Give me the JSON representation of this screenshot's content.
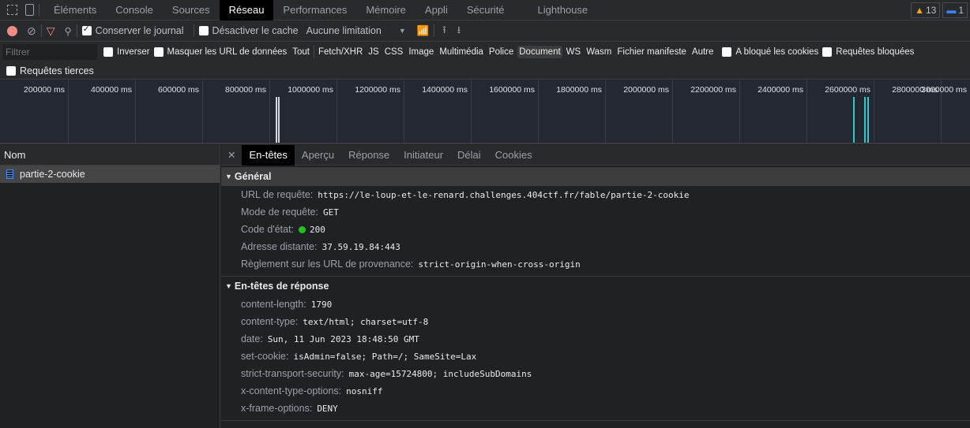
{
  "tabs": [
    "Éléments",
    "Console",
    "Sources",
    "Réseau",
    "Performances",
    "Mémoire",
    "Appli",
    "Sécurité",
    "Lighthouse"
  ],
  "active_tab": "Réseau",
  "badges": {
    "warnings": "13",
    "messages": "1"
  },
  "toolbar": {
    "preserve_log": "Conserver le journal",
    "disable_cache": "Désactiver le cache",
    "throttling": "Aucune limitation"
  },
  "filter": {
    "placeholder": "Filtrer",
    "invert": "Inverser",
    "hide_data_urls": "Masquer les URL de données",
    "types": [
      "Tout",
      "Fetch/XHR",
      "JS",
      "CSS",
      "Image",
      "Multimédia",
      "Police",
      "Document",
      "WS",
      "Wasm",
      "Fichier manifeste",
      "Autre"
    ],
    "selected_type": "Document",
    "blocked_cookies": "A bloqué les cookies",
    "blocked_requests": "Requêtes bloquées",
    "third_party": "Requêtes tierces"
  },
  "overview": {
    "ticks": [
      "200000 ms",
      "400000 ms",
      "600000 ms",
      "800000 ms",
      "1000000 ms",
      "1200000 ms",
      "1400000 ms",
      "1600000 ms",
      "1800000 ms",
      "2000000 ms",
      "2200000 ms",
      "2400000 ms",
      "2600000 ms",
      "2800000 ms",
      "3000000 ms"
    ]
  },
  "requests": {
    "header": "Nom",
    "items": [
      "partie-2-cookie"
    ]
  },
  "details": {
    "tabs": [
      "En-têtes",
      "Aperçu",
      "Réponse",
      "Initiateur",
      "Délai",
      "Cookies"
    ],
    "general": {
      "title": "Général",
      "rows": [
        {
          "k": "URL de requête:",
          "v": "https://le-loup-et-le-renard.challenges.404ctf.fr/fable/partie-2-cookie"
        },
        {
          "k": "Mode de requête:",
          "v": "GET"
        },
        {
          "k": "Code d'état:",
          "v": "200"
        },
        {
          "k": "Adresse distante:",
          "v": "37.59.19.84:443"
        },
        {
          "k": "Règlement sur les URL de provenance:",
          "v": "strict-origin-when-cross-origin"
        }
      ]
    },
    "response": {
      "title": "En-têtes de réponse",
      "rows": [
        {
          "k": "content-length:",
          "v": "1790"
        },
        {
          "k": "content-type:",
          "v": "text/html; charset=utf-8"
        },
        {
          "k": "date:",
          "v": "Sun, 11 Jun 2023 18:48:50 GMT"
        },
        {
          "k": "set-cookie:",
          "v": "isAdmin=false; Path=/; SameSite=Lax"
        },
        {
          "k": "strict-transport-security:",
          "v": "max-age=15724800; includeSubDomains"
        },
        {
          "k": "x-content-type-options:",
          "v": "nosniff"
        },
        {
          "k": "x-frame-options:",
          "v": "DENY"
        }
      ]
    }
  }
}
